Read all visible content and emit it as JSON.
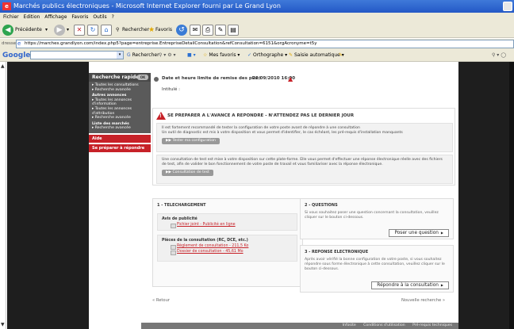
{
  "window": {
    "title": "Marchés publics électroniques - Microsoft Internet Explorer fourni par Le Grand Lyon"
  },
  "menu": [
    "Fichier",
    "Edition",
    "Affichage",
    "Favoris",
    "Outils",
    "?"
  ],
  "toolbar": {
    "back": "Précédente",
    "search": "Rechercher",
    "favorites": "Favoris"
  },
  "address": {
    "label": "dresse",
    "url": "https://marches.grandlyon.com/index.php5?page=entreprise.EntrepriseDetailConsultation&refConsultation=6151&orgAcronyme=t5y"
  },
  "google_bar": {
    "logo": "Google",
    "search_label": "Rechercher",
    "favorites": "Mes favoris",
    "spell": "Orthographe",
    "autofill": "Saisie automatique"
  },
  "sidebar": {
    "quick_search": "Recherche rapide",
    "go": "OK",
    "items1": [
      "Toutes les consultations",
      "Recherche avancée"
    ],
    "section2_title": "Autres annonces",
    "items2": [
      "Toutes les annonces d'information",
      "Toutes les annonces d'attribution",
      "Recherche avancée"
    ],
    "section3_title": "Liste des marchés",
    "items3": [
      "Recherche avancée"
    ],
    "help": "Aide",
    "prepare": "Se préparer à répondre"
  },
  "consultation": {
    "deadline_label": "Date et heure limite de remise des plis :",
    "deadline_value": "20/09/2010 16:00",
    "title_label": "Intitulé :"
  },
  "warning": {
    "title": "SE PREPARER A L'AVANCE A REPONDRE - N'ATTENDEZ PAS LE DERNIER JOUR",
    "block1_line1": "Il est fortement recommandé de tester la configuration de votre poste avant de répondre à une consultation",
    "block1_line2": "Un outil de diagnostic est mis à votre disposition et vous permet d'identifier, le cas échéant, les pré-requis d'installation manquants",
    "test_config": "Tester ma configuration",
    "block2_text": "Une consultation de test est mise à votre disposition sur cette plate-forme. Elle vous permet d'effectuer une réponse électronique réelle avec des fichiers de test, afin de valider le bon fonctionnement de votre poste de travail et vous familiariser avec la réponse électronique.",
    "test_consultation": "Consultation de test"
  },
  "download": {
    "title": "1 - TELECHARGEMENT",
    "notice_title": "Avis de publicité",
    "notice_link": "Fichier joint - Publicité en ligne",
    "docs_title": "Pièces de la consultation (RC, DCE, etc.)",
    "rules_link": "Règlement de consultation - 211,5 Ko",
    "file_link": "Dossier de consultation - 45,61 Mo"
  },
  "questions": {
    "title": "2 - QUESTIONS",
    "text": "Si vous souhaitez poser une question concernant la consultation, veuillez cliquer sur le bouton ci-dessous.",
    "button": "Poser une question"
  },
  "response": {
    "title": "3 - REPONSE ELECTRONIQUE",
    "text": "Après avoir vérifié la bonne configuration de votre poste, si vous souhaitez répondre sous forme électronique à cette consultation, veuillez cliquer sur le bouton ci-dessous.",
    "button": "Répondre à la consultation"
  },
  "nav": {
    "back": "« Retour",
    "new_search": "Nouvelle recherche »"
  },
  "footer": [
    "Infosite",
    "Conditions d'utilisation",
    "Pré-requis techniques"
  ]
}
